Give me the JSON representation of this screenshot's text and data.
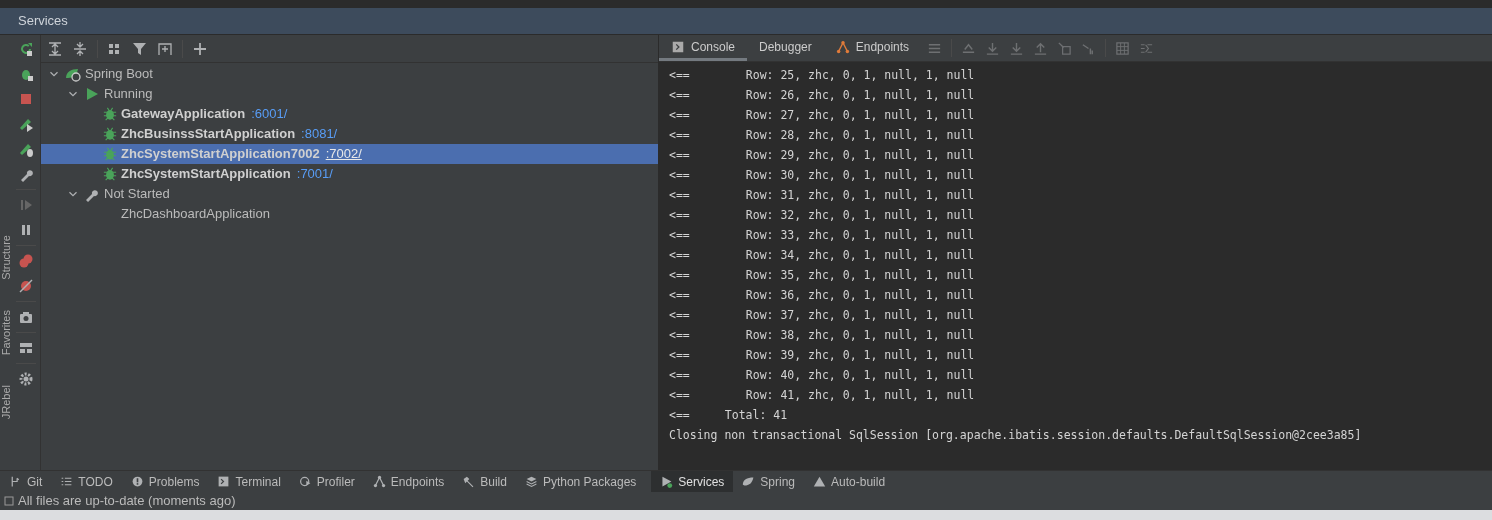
{
  "panel": {
    "title": "Services"
  },
  "side_labels": [
    "Structure",
    "Favorites",
    "JRebel"
  ],
  "tree": [
    {
      "kind": "spring-boot",
      "label": "Spring Boot",
      "expanded": true,
      "children": [
        {
          "kind": "running-group",
          "label": "Running",
          "expanded": true,
          "children": [
            {
              "kind": "app",
              "label": "GatewayApplication",
              "port": ":6001/",
              "running": true,
              "selected": false
            },
            {
              "kind": "app",
              "label": "ZhcBusinssStartApplication",
              "port": ":8081/",
              "running": true,
              "selected": false
            },
            {
              "kind": "app",
              "label": "ZhcSystemStartApplication7002",
              "port": ":7002/",
              "running": true,
              "selected": true
            },
            {
              "kind": "app",
              "label": "ZhcSystemStartApplication",
              "port": ":7001/",
              "running": true,
              "selected": false
            }
          ]
        },
        {
          "kind": "stopped-group",
          "label": "Not Started",
          "expanded": true,
          "children": [
            {
              "kind": "app",
              "label": "ZhcDashboardApplication",
              "running": false,
              "selected": false
            }
          ]
        }
      ]
    }
  ],
  "console_tabs": [
    {
      "kind": "console",
      "label": "Console",
      "selected": true
    },
    {
      "kind": "plain",
      "label": "Debugger",
      "selected": false
    },
    {
      "kind": "endpoints",
      "label": "Endpoints",
      "selected": false
    }
  ],
  "console_lines": [
    {
      "kind": "row",
      "marker": "<==",
      "text": "Row: 25, zhc, 0, 1, null, 1, null"
    },
    {
      "kind": "row",
      "marker": "<==",
      "text": "Row: 26, zhc, 0, 1, null, 1, null"
    },
    {
      "kind": "row",
      "marker": "<==",
      "text": "Row: 27, zhc, 0, 1, null, 1, null"
    },
    {
      "kind": "row",
      "marker": "<==",
      "text": "Row: 28, zhc, 0, 1, null, 1, null"
    },
    {
      "kind": "row",
      "marker": "<==",
      "text": "Row: 29, zhc, 0, 1, null, 1, null"
    },
    {
      "kind": "row",
      "marker": "<==",
      "text": "Row: 30, zhc, 0, 1, null, 1, null"
    },
    {
      "kind": "row",
      "marker": "<==",
      "text": "Row: 31, zhc, 0, 1, null, 1, null"
    },
    {
      "kind": "row",
      "marker": "<==",
      "text": "Row: 32, zhc, 0, 1, null, 1, null"
    },
    {
      "kind": "row",
      "marker": "<==",
      "text": "Row: 33, zhc, 0, 1, null, 1, null"
    },
    {
      "kind": "row",
      "marker": "<==",
      "text": "Row: 34, zhc, 0, 1, null, 1, null"
    },
    {
      "kind": "row",
      "marker": "<==",
      "text": "Row: 35, zhc, 0, 1, null, 1, null"
    },
    {
      "kind": "row",
      "marker": "<==",
      "text": "Row: 36, zhc, 0, 1, null, 1, null"
    },
    {
      "kind": "row",
      "marker": "<==",
      "text": "Row: 37, zhc, 0, 1, null, 1, null"
    },
    {
      "kind": "row",
      "marker": "<==",
      "text": "Row: 38, zhc, 0, 1, null, 1, null"
    },
    {
      "kind": "row",
      "marker": "<==",
      "text": "Row: 39, zhc, 0, 1, null, 1, null"
    },
    {
      "kind": "row",
      "marker": "<==",
      "text": "Row: 40, zhc, 0, 1, null, 1, null"
    },
    {
      "kind": "row",
      "marker": "<==",
      "text": "Row: 41, zhc, 0, 1, null, 1, null"
    },
    {
      "kind": "total",
      "marker": "<==",
      "text": "Total: 41"
    },
    {
      "kind": "log",
      "text": "Closing non transactional SqlSession [org.apache.ibatis.session.defaults.DefaultSqlSession@2cee3a85]"
    }
  ],
  "tool_tabs": [
    {
      "kind": "git",
      "label": "Git",
      "selected": false
    },
    {
      "kind": "todo",
      "label": "TODO",
      "selected": false
    },
    {
      "kind": "problems",
      "label": "Problems",
      "selected": false
    },
    {
      "kind": "terminal",
      "label": "Terminal",
      "selected": false
    },
    {
      "kind": "profiler",
      "label": "Profiler",
      "selected": false
    },
    {
      "kind": "endpoints",
      "label": "Endpoints",
      "selected": false
    },
    {
      "kind": "build",
      "label": "Build",
      "selected": false
    },
    {
      "kind": "packages",
      "label": "Python Packages",
      "selected": false
    },
    {
      "kind": "services",
      "label": "Services",
      "selected": true
    },
    {
      "kind": "spring",
      "label": "Spring",
      "selected": false
    },
    {
      "kind": "warning",
      "label": "Auto-build",
      "selected": false
    }
  ],
  "status_bar": {
    "text": "All files are up-to-date (moments ago)"
  }
}
